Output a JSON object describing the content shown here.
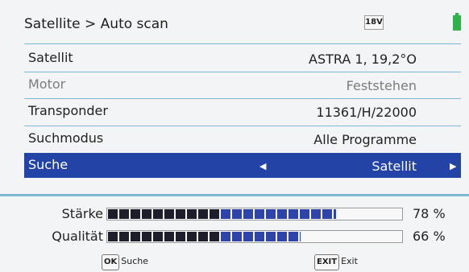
{
  "header": {
    "title": "Satellite > Auto scan",
    "voltage": "18V",
    "battery_icon": "battery-icon"
  },
  "rows": [
    {
      "label": "Satellit",
      "value": "ASTRA 1, 19,2°O",
      "state": "normal"
    },
    {
      "label": "Motor",
      "value": "Feststehen",
      "state": "muted"
    },
    {
      "label": "Transponder",
      "value": "11361/H/22000",
      "state": "normal"
    },
    {
      "label": "Suchmodus",
      "value": "Alle Programme",
      "state": "normal"
    },
    {
      "label": "Suche",
      "value": "Satellit",
      "state": "selected"
    }
  ],
  "meters": {
    "strength": {
      "label": "Stärke",
      "percent": 78,
      "display": "78 %"
    },
    "quality": {
      "label": "Qualität",
      "percent": 66,
      "display": "66 %"
    }
  },
  "footer": {
    "ok": {
      "key": "OK",
      "label": "Suche"
    },
    "exit": {
      "key": "EXIT",
      "label": "Exit"
    }
  },
  "colors": {
    "selected": "#2343a6",
    "dark_segment": "#1e1e2a",
    "blue_segment": "#2f44a8",
    "separator": "#7fb5d5",
    "battery": "#2fb24a"
  }
}
